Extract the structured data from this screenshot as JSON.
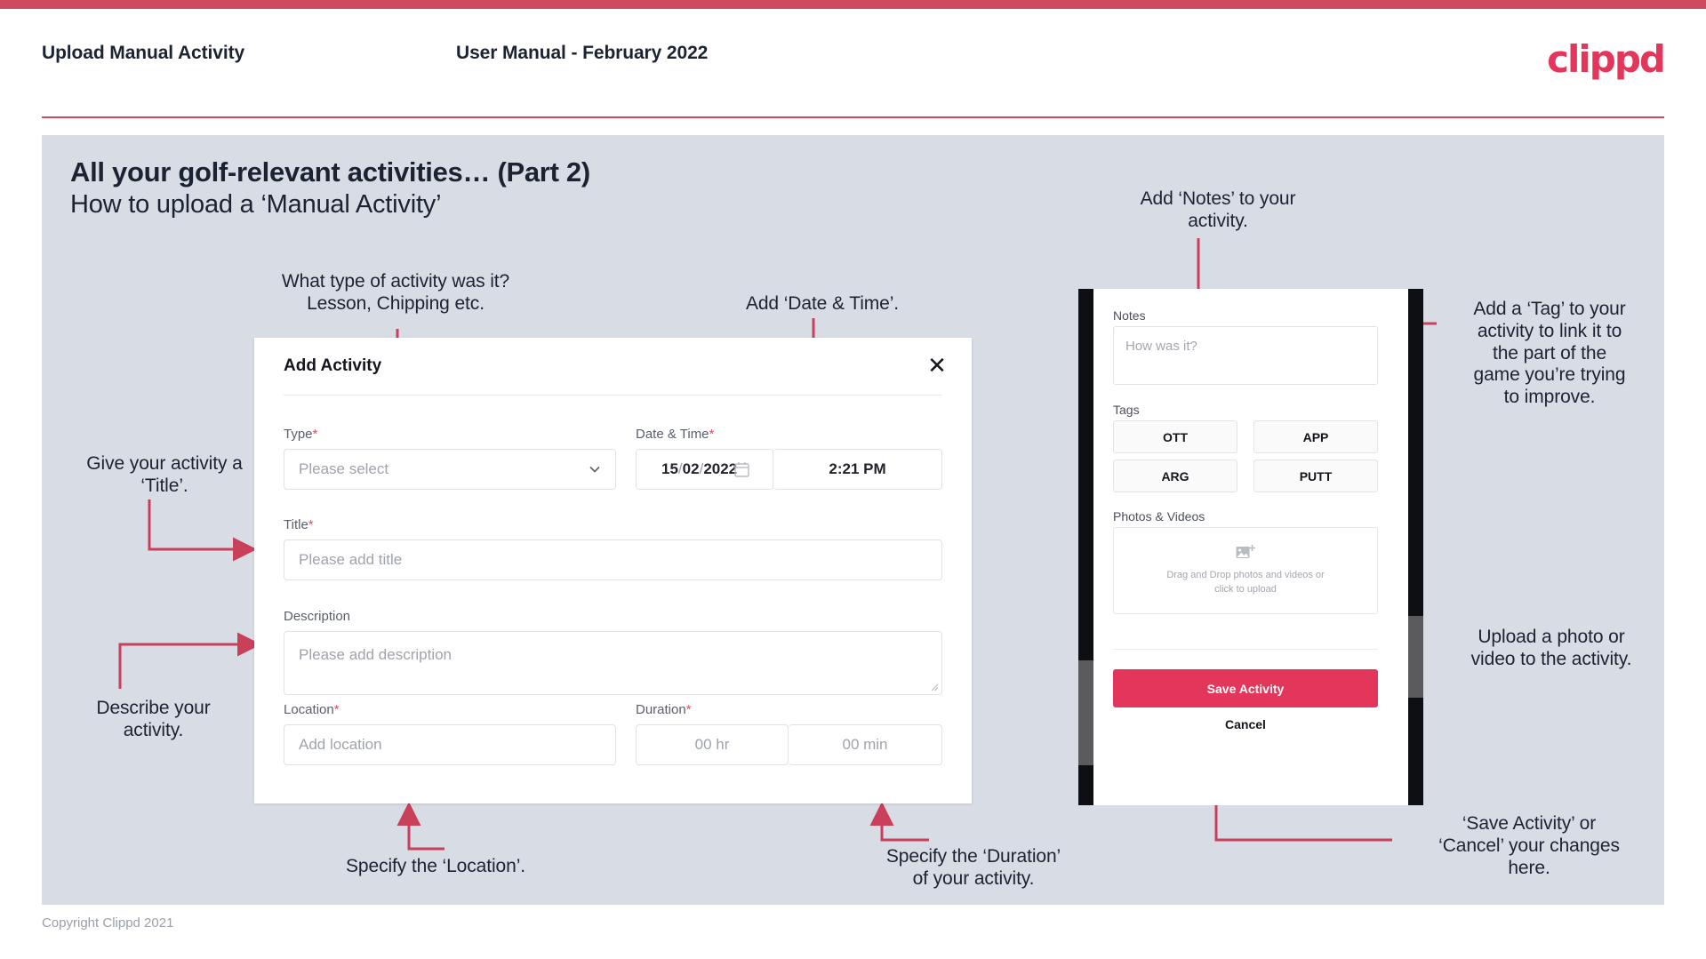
{
  "brand": {
    "logo_text": "clippd",
    "accent": "#e4365a",
    "bar": "#d04a5f",
    "slide_bg": "#d8dde5",
    "ink": "#1b2333"
  },
  "header": {
    "title": "Upload Manual Activity",
    "subtitle": "User Manual - February 2022"
  },
  "slide": {
    "title": "All your golf-relevant activities… (Part 2)",
    "subtitle": "How to upload a ‘Manual Activity’"
  },
  "annotations": {
    "type": "What type of activity was it?\nLesson, Chipping etc.",
    "datetime": "Add ‘Date & Time’.",
    "title": "Give your activity a\n‘Title’.",
    "description": "Describe your\nactivity.",
    "location": "Specify the ‘Location’.",
    "duration": "Specify the ‘Duration’\nof your activity.",
    "notes": "Add ‘Notes’ to your\nactivity.",
    "tags": "Add a ‘Tag’ to your\nactivity to link it to\nthe part of the\ngame you’re trying\nto improve.",
    "photos": "Upload a photo or\nvideo to the activity.",
    "save": "‘Save Activity’ or\n‘Cancel’ your changes\nhere."
  },
  "dialog": {
    "title": "Add Activity",
    "close_icon": "close-icon",
    "fields": {
      "type": {
        "label": "Type",
        "required": "*",
        "placeholder": "Please select"
      },
      "datetime": {
        "label": "Date & Time",
        "required": "*",
        "day": "15",
        "sep1": "/",
        "month": "02",
        "sep2": "/",
        "year": "2022",
        "time": "2:21 PM"
      },
      "title": {
        "label": "Title",
        "required": "*",
        "placeholder": "Please add title"
      },
      "description": {
        "label": "Description",
        "required": "",
        "placeholder": "Please add description"
      },
      "location": {
        "label": "Location",
        "required": "*",
        "placeholder": "Add location"
      },
      "duration": {
        "label": "Duration",
        "required": "*",
        "hours": "00 hr",
        "minutes": "00 min"
      }
    }
  },
  "phone": {
    "notes": {
      "label": "Notes",
      "placeholder": "How was it?"
    },
    "tags": {
      "label": "Tags",
      "items": [
        "OTT",
        "APP",
        "ARG",
        "PUTT"
      ]
    },
    "photos": {
      "label": "Photos & Videos",
      "dropzone_line1": "Drag and Drop photos and videos or",
      "dropzone_line2": "click to upload"
    },
    "save_label": "Save Activity",
    "cancel_label": "Cancel"
  },
  "footer": {
    "copyright": "Copyright Clippd 2021"
  }
}
